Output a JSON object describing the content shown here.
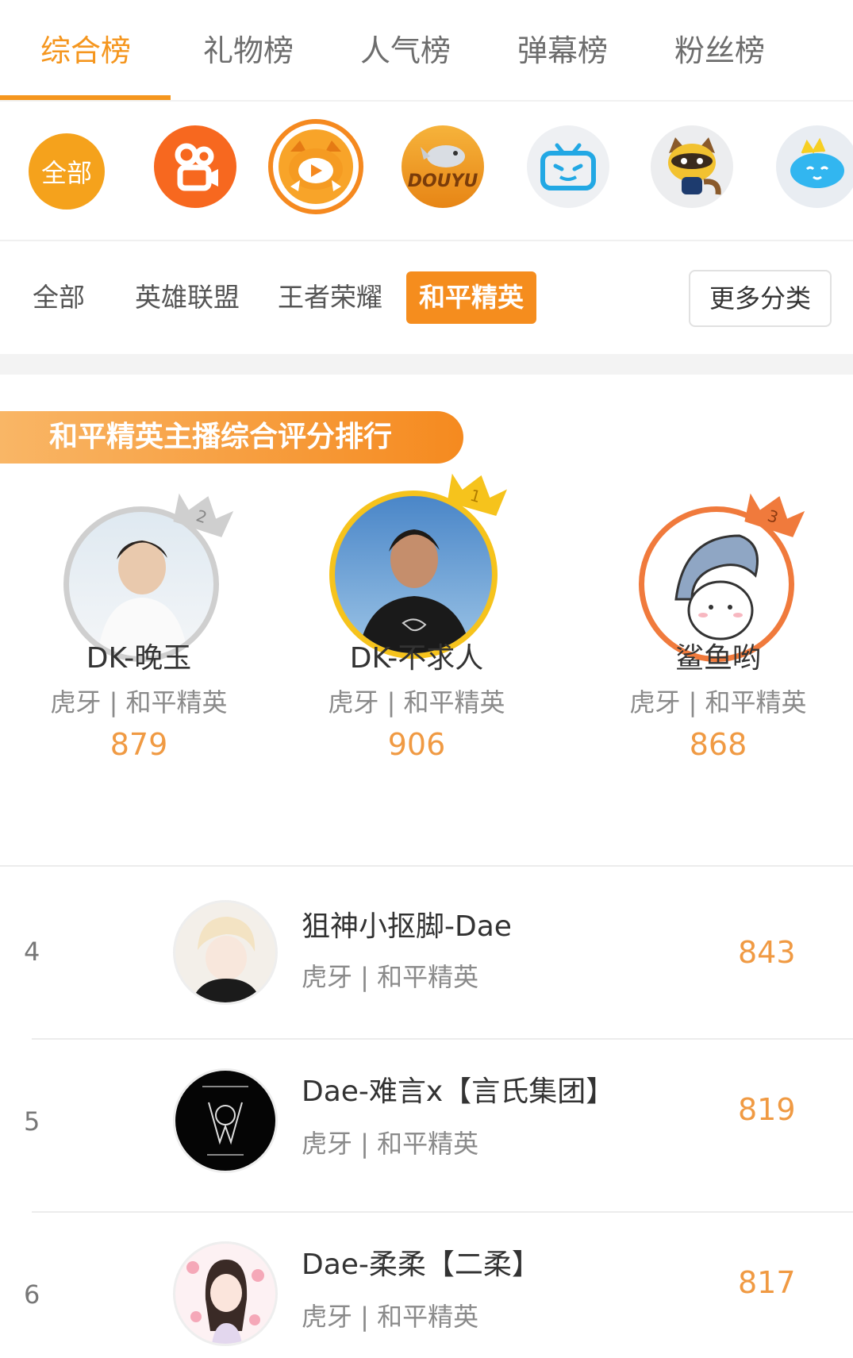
{
  "tabs": [
    {
      "label": "综合榜",
      "active": true
    },
    {
      "label": "礼物榜",
      "active": false
    },
    {
      "label": "人气榜",
      "active": false
    },
    {
      "label": "弹幕榜",
      "active": false
    },
    {
      "label": "粉丝榜",
      "active": false
    }
  ],
  "platforms": {
    "all_label": "全部",
    "items": [
      "kuaishou-icon",
      "huya-icon",
      "douyu-icon",
      "bilibili-icon",
      "yy-icon",
      "chushou-icon"
    ],
    "douyu_text": "DOUYU"
  },
  "categories": {
    "items": [
      {
        "label": "全部",
        "active": false
      },
      {
        "label": "英雄联盟",
        "active": false
      },
      {
        "label": "王者荣耀",
        "active": false
      },
      {
        "label": "和平精英",
        "active": true
      }
    ],
    "more_label": "更多分类"
  },
  "banner": {
    "title": "和平精英主播综合评分排行"
  },
  "podium": [
    {
      "rank": "2",
      "name": "DK-晚玉",
      "platform": "虎牙 | 和平精英",
      "score": "879"
    },
    {
      "rank": "1",
      "name": "DK-不求人",
      "platform": "虎牙 | 和平精英",
      "score": "906"
    },
    {
      "rank": "3",
      "name": "鲨鱼哟",
      "platform": "虎牙 | 和平精英",
      "score": "868"
    }
  ],
  "list": [
    {
      "rank": "4",
      "name": "狙神小抠脚-Dae",
      "platform": "虎牙 | 和平精英",
      "score": "843"
    },
    {
      "rank": "5",
      "name": "Dae-难言x【言氏集团】",
      "platform": "虎牙 | 和平精英",
      "score": "819"
    },
    {
      "rank": "6",
      "name": "Dae-柔柔【二柔】",
      "platform": "虎牙 | 和平精英",
      "score": "817"
    }
  ],
  "colors": {
    "accent": "#f5961e",
    "score": "#f09a43",
    "gold": "#f5c21b",
    "silver": "#c9c9c9",
    "bronze": "#f07a3c"
  }
}
